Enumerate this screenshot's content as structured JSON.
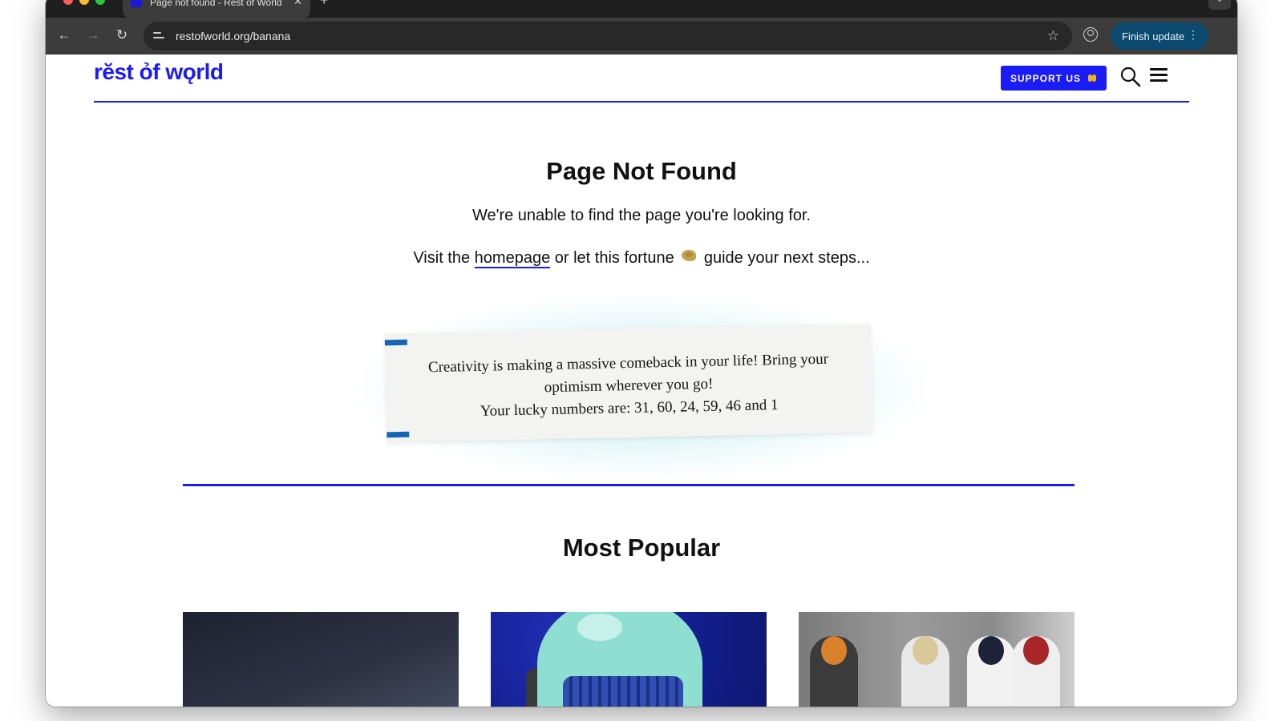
{
  "browser": {
    "tab_title": "Page not found - Rest of World",
    "tab_close": "✕",
    "new_tab": "+",
    "tab_menu": "⌄",
    "url": "restofworld.org/banana",
    "finish_update": "Finish update"
  },
  "site": {
    "logo": "rĕst ỏf wǫrld",
    "support_label": "SUPPORT US"
  },
  "main": {
    "heading": "Page Not Found",
    "unable_text": "We're unable to find the page you're looking for.",
    "visit_prefix": "Visit the",
    "homepage_link": "homepage",
    "visit_middle": "or let this fortune",
    "visit_suffix": "guide your next steps..."
  },
  "fortune": {
    "line1": "Creativity is making a massive comeback in your life! Bring your",
    "line2": "optimism wherever you go!",
    "line3": "Your lucky numbers are: 31, 60, 24, 59, 46 and 1"
  },
  "popular": {
    "heading": "Most Popular"
  },
  "colors": {
    "brand_blue": "#1b1bf5",
    "fortune_tag": "#1565b7",
    "finish_update_bg": "#0b4a6e"
  },
  "icons": [
    "back-arrow-icon",
    "forward-arrow-icon",
    "reload-icon",
    "site-info-icon",
    "star-icon",
    "profile-icon",
    "kebab-menu-icon",
    "heart-icon",
    "search-icon",
    "hamburger-menu-icon",
    "fortune-cookie-icon"
  ]
}
